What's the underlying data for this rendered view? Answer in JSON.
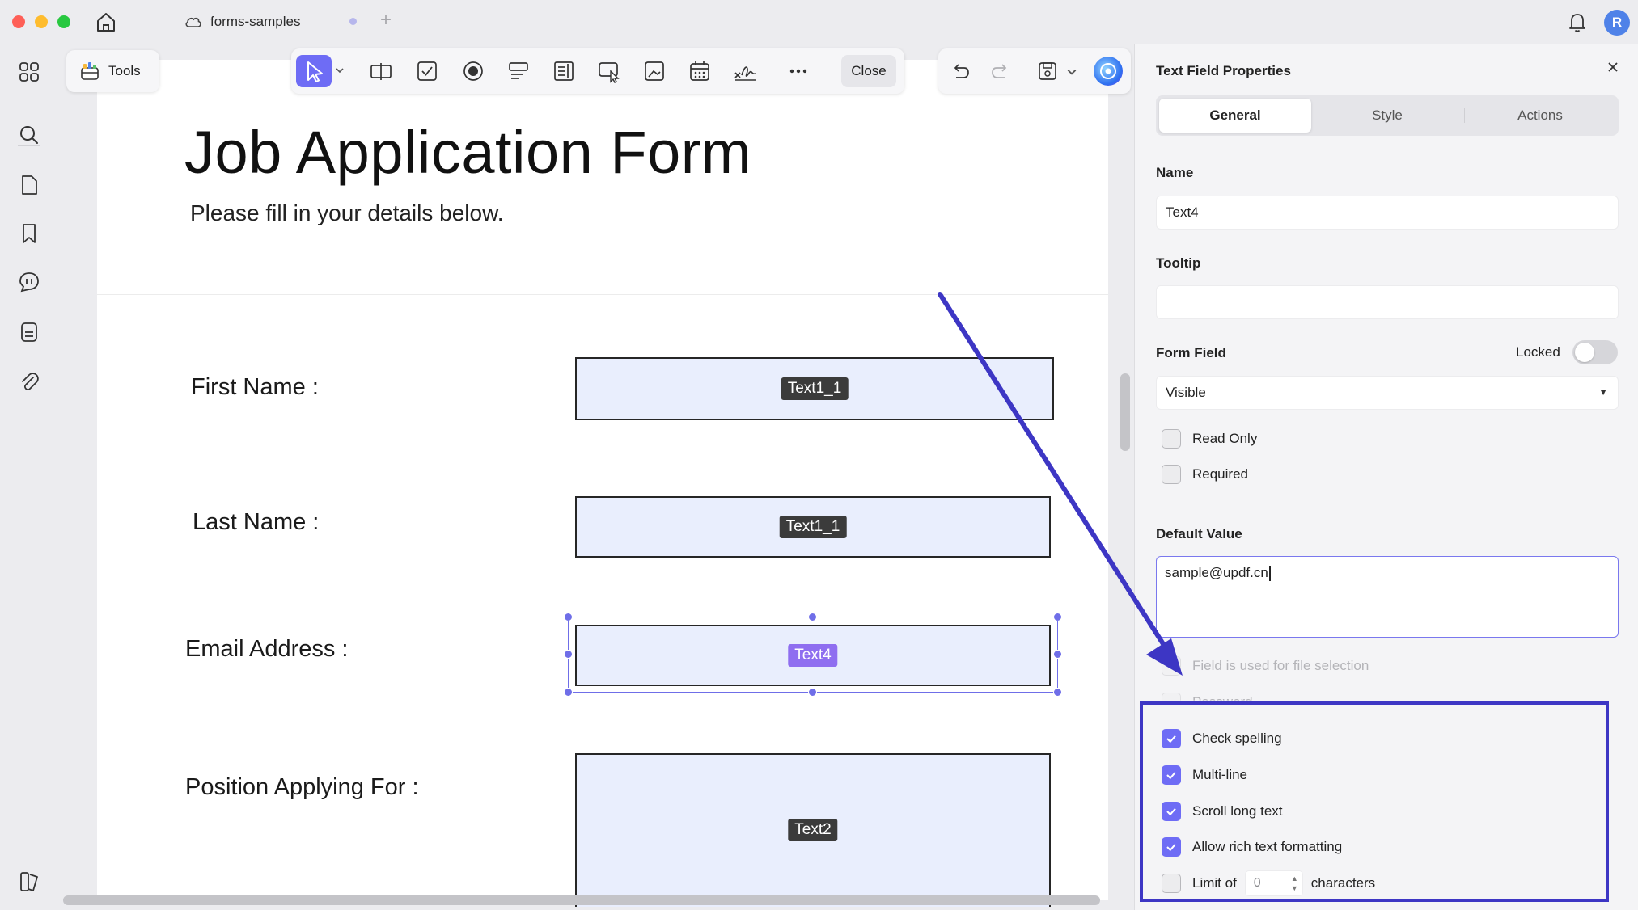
{
  "titlebar": {
    "tab_title": "forms-samples",
    "avatar_initial": "R"
  },
  "toolbar": {
    "tools_label": "Tools",
    "close_label": "Close"
  },
  "document": {
    "title": "Job Application Form",
    "subtitle": "Please fill in your details below.",
    "fields": [
      {
        "label": "First Name :",
        "tag": "Text1_1"
      },
      {
        "label": "Last Name :",
        "tag": "Text1_1"
      },
      {
        "label": "Email Address :",
        "tag": "Text4"
      },
      {
        "label": "Position Applying For :",
        "tag": "Text2"
      }
    ]
  },
  "panel": {
    "title": "Text Field Properties",
    "tabs": [
      "General",
      "Style",
      "Actions"
    ],
    "active_tab": "General",
    "name_label": "Name",
    "name_value": "Text4",
    "tooltip_label": "Tooltip",
    "tooltip_value": "",
    "form_field_label": "Form Field",
    "locked_label": "Locked",
    "visibility_value": "Visible",
    "read_only_label": "Read Only",
    "required_label": "Required",
    "default_value_label": "Default Value",
    "default_value": "sample@updf.cn",
    "options": [
      {
        "label": "Field is used for file selection",
        "checked": false,
        "disabled": true
      },
      {
        "label": "Password",
        "checked": false,
        "disabled": true
      },
      {
        "label": "Check spelling",
        "checked": true,
        "disabled": false
      },
      {
        "label": "Multi-line",
        "checked": true,
        "disabled": false
      },
      {
        "label": "Scroll long text",
        "checked": true,
        "disabled": false
      },
      {
        "label": "Allow rich text formatting",
        "checked": true,
        "disabled": false
      }
    ],
    "limit_prefix": "Limit of",
    "limit_value": "0",
    "limit_suffix": "characters"
  },
  "colors": {
    "accent": "#6e6cf5",
    "annotation": "#3d36c4"
  }
}
